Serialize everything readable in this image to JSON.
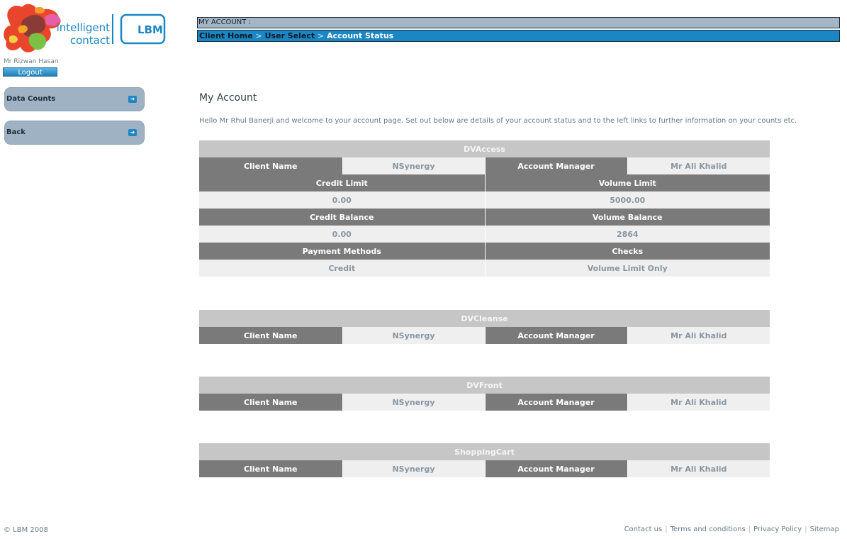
{
  "header": {
    "brand_line1": "intelligent",
    "brand_line2": "contact",
    "brand_badge": "LBM",
    "user_name": "Mr Rizwan Hasan",
    "logout_label": "Logout"
  },
  "sidebar": {
    "items": [
      {
        "label": "Data Counts",
        "icon": "arrow-right-icon"
      },
      {
        "label": "Back",
        "icon": "arrow-right-icon"
      }
    ]
  },
  "topbar": {
    "title": "MY ACCOUNT :",
    "breadcrumb": [
      "Client Home",
      "User Select",
      "Account Status"
    ],
    "separator": ">"
  },
  "main": {
    "heading": "My Account",
    "intro": "Hello Mr Rhul Banerji and welcome to your account page. Set out below are details of your account status and to the left links to further information on your counts etc."
  },
  "labels": {
    "client_name": "Client Name",
    "account_manager": "Account Manager",
    "credit_limit": "Credit Limit",
    "volume_limit": "Volume Limit",
    "credit_balance": "Credit Balance",
    "volume_balance": "Volume Balance",
    "payment_methods": "Payment Methods",
    "checks": "Checks"
  },
  "sections": [
    {
      "name": "DVAccess",
      "client": "NSynergy",
      "manager": "Mr Ali Khalid",
      "credit_limit": "0.00",
      "volume_limit": "5000.00",
      "credit_balance": "0.00",
      "volume_balance": "2864",
      "payment_method": "Credit",
      "checks": "Volume Limit Only"
    },
    {
      "name": "DVCleanse",
      "client": "NSynergy",
      "manager": "Mr Ali Khalid"
    },
    {
      "name": "DVFront",
      "client": "NSynergy",
      "manager": "Mr Ali Khalid"
    },
    {
      "name": "ShoppingCart",
      "client": "NSynergy",
      "manager": "Mr Ali Khalid"
    }
  ],
  "footer": {
    "copyright": "© LBM 2008",
    "links": [
      "Contact us",
      "Terms and conditions",
      "Privacy Policy",
      "Sitemap"
    ],
    "separator": "|"
  },
  "colors": {
    "accent": "#1a86c3",
    "title_bar": "#a3b5c6",
    "sidebar_button": "#9eb2c3",
    "table_dark": "#7a7a7a",
    "table_light": "#efefef",
    "table_header": "#c6c6c6"
  }
}
